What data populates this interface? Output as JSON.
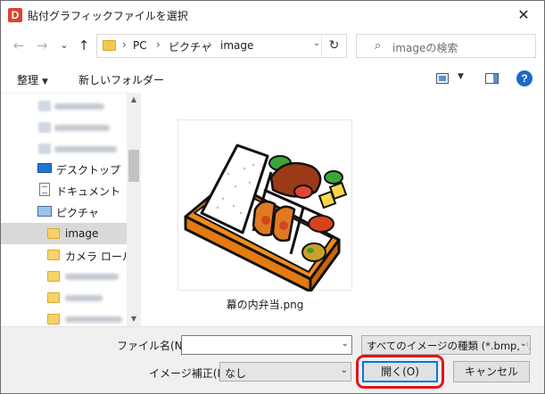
{
  "window": {
    "app_icon_letter": "D",
    "title": "貼付グラフィックファイルを選択",
    "close_glyph": "✕"
  },
  "nav": {
    "back_glyph": "←",
    "forward_glyph": "→",
    "recent_glyph": "⌄",
    "up_glyph": "↑",
    "breadcrumb": [
      "PC",
      "ピクチャ",
      "image"
    ],
    "separator": "›",
    "dropdown_glyph": "⌄",
    "refresh_glyph": "↻",
    "search_icon_glyph": "⌕",
    "search_placeholder": "imageの検索"
  },
  "toolbar": {
    "organize_label": "整理",
    "organize_caret": "▼",
    "new_folder_label": "新しいフォルダー",
    "view_caret": "▼",
    "help_glyph": "?"
  },
  "sidebar": {
    "items": [
      {
        "label": "デスクトップ",
        "icon": "desktop-icon"
      },
      {
        "label": "ドキュメント",
        "icon": "document-icon"
      },
      {
        "label": "ピクチャ",
        "icon": "pictures-icon"
      },
      {
        "label": "image",
        "icon": "folder-icon",
        "selected": true
      },
      {
        "label": "カメラ ロール",
        "icon": "folder-icon"
      }
    ],
    "scroll_up_glyph": "▲",
    "scroll_down_glyph": "▼"
  },
  "content": {
    "files": [
      {
        "name": "幕の内弁当.png",
        "thumbnail": "bento-box-illustration"
      }
    ]
  },
  "footer": {
    "filename_label": "ファイル名(N):",
    "filename_value": "",
    "filetype_value": "すべてのイメージの種類 (*.bmp, *.c",
    "correction_label": "イメージ補正(I)",
    "correction_value": "なし",
    "open_button": "開く(O)",
    "cancel_button": "キャンセル",
    "dropdown_glyph": "⌄"
  },
  "colors": {
    "accent": "#0078d7",
    "highlight_ring": "#e3141b",
    "selected_nav": "#d9d9d9"
  }
}
